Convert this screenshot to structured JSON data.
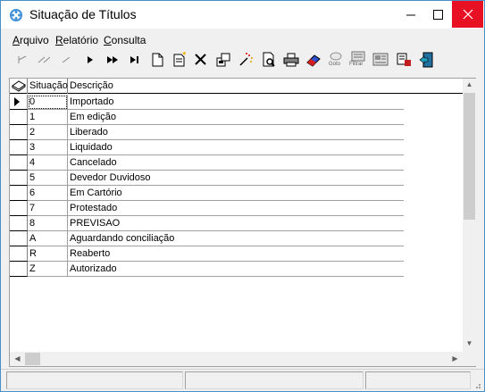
{
  "window": {
    "title": "Situação de Títulos"
  },
  "menu": {
    "items": [
      {
        "label": "Arquivo",
        "mnemonic": "A",
        "rest": "rquivo"
      },
      {
        "label": "Relatório",
        "mnemonic": "R",
        "rest": "elatório"
      },
      {
        "label": "Consulta",
        "mnemonic": "C",
        "rest": "onsulta"
      }
    ]
  },
  "toolbar": {
    "buttons": [
      {
        "icon": "first-record-icon"
      },
      {
        "icon": "prev-page-icon"
      },
      {
        "icon": "prev-record-icon"
      },
      {
        "icon": "next-record-icon"
      },
      {
        "icon": "next-page-icon"
      },
      {
        "icon": "last-record-icon"
      },
      {
        "icon": "new-document-icon"
      },
      {
        "icon": "edit-document-icon"
      },
      {
        "icon": "delete-icon"
      },
      {
        "icon": "properties-icon"
      },
      {
        "icon": "magic-wand-icon"
      },
      {
        "icon": "print-preview-icon"
      },
      {
        "icon": "print-icon"
      },
      {
        "icon": "eraser-icon"
      },
      {
        "icon": "goto-icon",
        "caption": "Goto"
      },
      {
        "icon": "filter-icon",
        "caption": "Filtrar"
      },
      {
        "icon": "report-icon"
      },
      {
        "icon": "export-icon"
      },
      {
        "icon": "exit-icon"
      }
    ]
  },
  "grid": {
    "headers": {
      "situacao": "Situação",
      "descricao": "Descrição"
    },
    "rows": [
      {
        "situacao": "0",
        "descricao": "Importado"
      },
      {
        "situacao": "1",
        "descricao": "Em edição"
      },
      {
        "situacao": "2",
        "descricao": "Liberado"
      },
      {
        "situacao": "3",
        "descricao": "Liquidado"
      },
      {
        "situacao": "4",
        "descricao": "Cancelado"
      },
      {
        "situacao": "5",
        "descricao": "Devedor Duvidoso"
      },
      {
        "situacao": "6",
        "descricao": "Em Cartório"
      },
      {
        "situacao": "7",
        "descricao": "Protestado"
      },
      {
        "situacao": "8",
        "descricao": "PREVISAO"
      },
      {
        "situacao": "A",
        "descricao": "Aguardando conciliação"
      },
      {
        "situacao": "R",
        "descricao": "Reaberto"
      },
      {
        "situacao": "Z",
        "descricao": "Autorizado"
      }
    ],
    "selected_index": 0
  },
  "colors": {
    "close_button": "#e81123",
    "window_border": "#4a90c8"
  }
}
